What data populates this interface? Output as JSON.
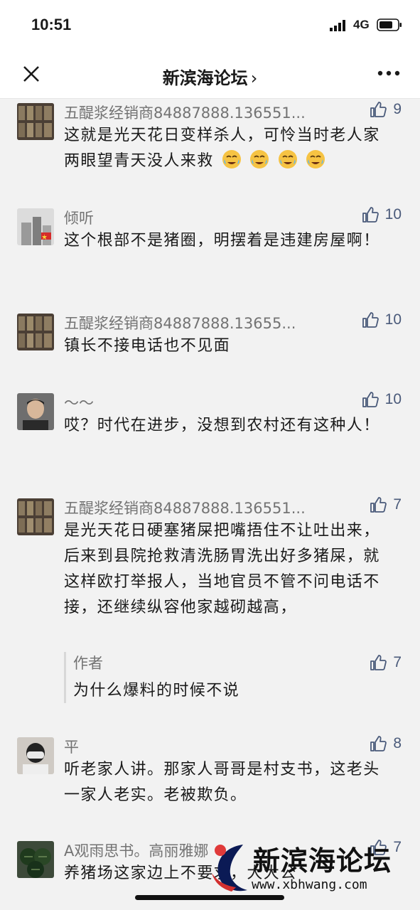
{
  "status_bar": {
    "time": "10:51",
    "network": "4G"
  },
  "nav": {
    "title": "新滨海论坛",
    "title_chevron": "›",
    "close_icon": "close-icon",
    "more_icon": "more-dots-icon"
  },
  "comments": [
    {
      "name": "五醍浆经销商84887888.136551...",
      "likes": "9",
      "text": "这就是光天花日变样杀人，可怜当时老人家两眼望青天没人来救",
      "emoji": [
        "crying-face-icon",
        "crying-face-icon",
        "crying-face-icon",
        "crying-face-icon"
      ]
    },
    {
      "name": "倾听",
      "likes": "10",
      "text": "这个根部不是猪圈，明摆着是违建房屋啊！"
    },
    {
      "name": "五醍浆经销商84887888.13655...",
      "likes": "10",
      "text": "镇长不接电话也不见面"
    },
    {
      "name": "～～",
      "likes": "10",
      "text": "哎？时代在进步，没想到农村还有这种人！"
    },
    {
      "name": "五醍浆经销商84887888.136551...",
      "likes": "7",
      "text": "是光天花日硬塞猪屎把嘴捂住不让吐出来，后来到县院抢救清洗肠胃洗出好多猪屎，就这样欧打举报人，当地官员不管不问电话不接，还继续纵容他家越砌越高，",
      "reply": {
        "name": "作者",
        "likes": "7",
        "text": "为什么爆料的时候不说"
      }
    },
    {
      "name": "平",
      "likes": "8",
      "text": "听老家人讲。那家人哥哥是村支书，这老头一家人老实。老被欺负。"
    },
    {
      "name": "A观雨思书。高丽雅娜",
      "likes": "7",
      "text": "养猪场这家边上不要求，大大公"
    }
  ],
  "watermark": {
    "title": "新滨海论坛",
    "url": "www.xbhwang.com"
  },
  "colors": {
    "like_icon": "#4a5a7a",
    "name_text": "#737373",
    "background": "#f2f2f2"
  }
}
